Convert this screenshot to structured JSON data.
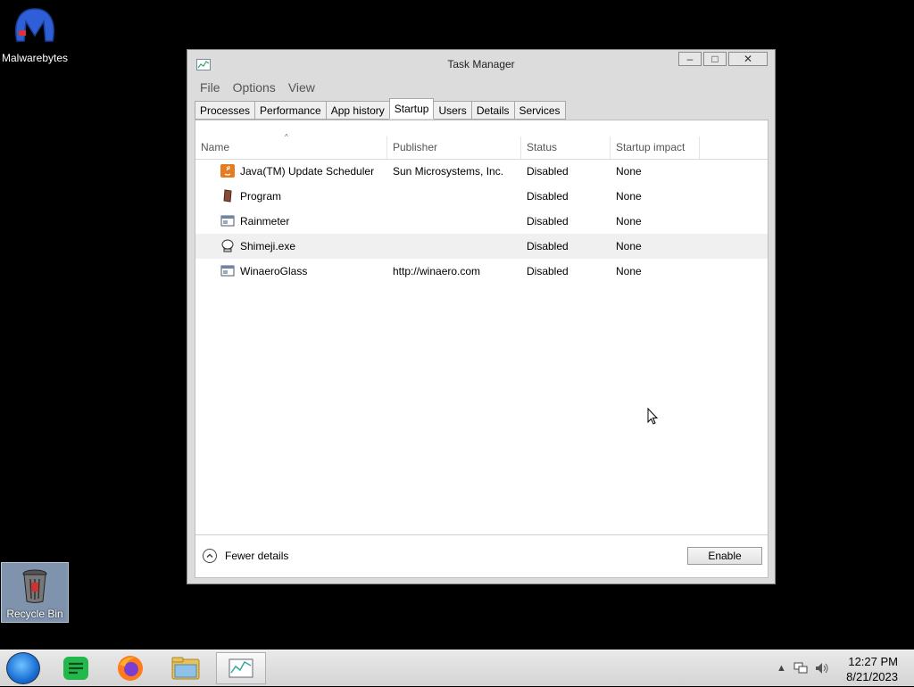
{
  "desktop": {
    "malwarebytes_label": "Malwarebytes",
    "recycle_bin_label": "Recycle Bin"
  },
  "window": {
    "title": "Task Manager",
    "controls": {
      "minimize": "–",
      "maximize": "□",
      "close": "✕"
    },
    "menu": [
      "File",
      "Options",
      "View"
    ],
    "tabs": [
      "Processes",
      "Performance",
      "App history",
      "Startup",
      "Users",
      "Details",
      "Services"
    ],
    "active_tab": "Startup"
  },
  "startup_table": {
    "columns": [
      "Name",
      "Publisher",
      "Status",
      "Startup impact"
    ],
    "sorted_by": "Name",
    "sort_icon": "^",
    "rows": [
      {
        "name": "Java(TM) Update Scheduler",
        "publisher": "Sun Microsystems, Inc.",
        "status": "Disabled",
        "impact": "None",
        "icon": "java-icon"
      },
      {
        "name": "Program",
        "publisher": "",
        "status": "Disabled",
        "impact": "None",
        "icon": "program-icon"
      },
      {
        "name": "Rainmeter",
        "publisher": "",
        "status": "Disabled",
        "impact": "None",
        "icon": "app-window-icon"
      },
      {
        "name": "Shimeji.exe",
        "publisher": "",
        "status": "Disabled",
        "impact": "None",
        "icon": "shimeji-icon"
      },
      {
        "name": "WinaeroGlass",
        "publisher": "http://winaero.com",
        "status": "Disabled",
        "impact": "None",
        "icon": "app-window-icon"
      }
    ],
    "hover_row": 3
  },
  "footer": {
    "fewer_details": "Fewer details",
    "enable_button": "Enable"
  },
  "taskbar": {
    "apps": [
      "start-orb",
      "spotify-like-app",
      "firefox",
      "file-explorer",
      "task-manager"
    ],
    "tray_arrow": "▲",
    "time": "12:27 PM",
    "date": "8/21/2023"
  },
  "colors": {
    "desktop_bg": "#000000",
    "window_frame": "#dcdcdc",
    "panel_bg": "#ffffff"
  }
}
